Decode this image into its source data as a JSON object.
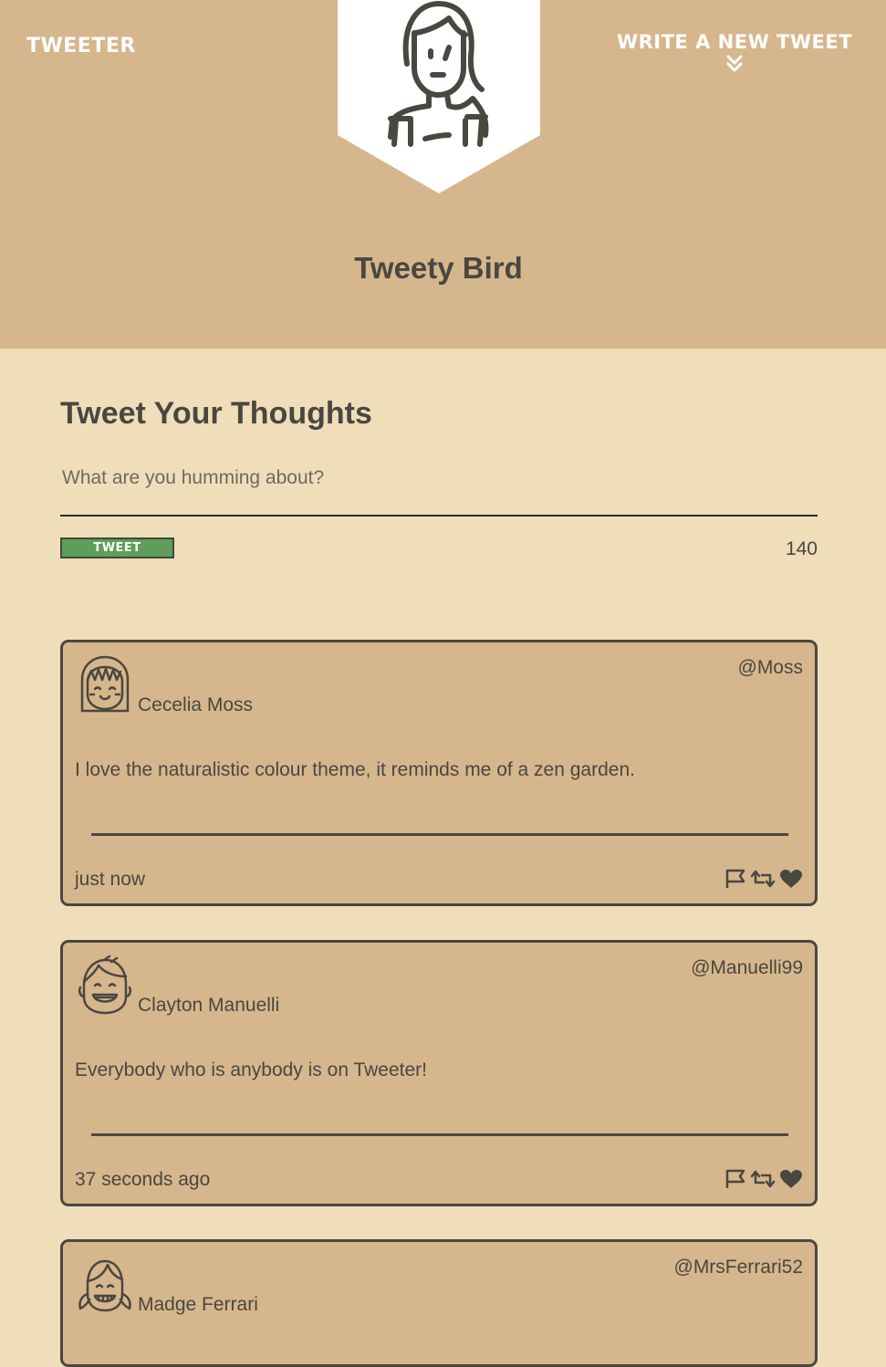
{
  "nav": {
    "brand": "TWEETER",
    "write_link": "WRITE A NEW TWEET"
  },
  "profile": {
    "name": "Tweety Bird",
    "avatar_icon": "woman-portrait-icon"
  },
  "compose": {
    "title": "Tweet Your Thoughts",
    "placeholder": "What are you humming about?",
    "button_label": "TWEET",
    "counter": "140"
  },
  "tweets": [
    {
      "author": "Cecelia Moss",
      "handle": "@Moss",
      "text": "I love the naturalistic colour theme, it reminds me of a zen garden.",
      "time": "just now",
      "avatar_icon": "girl-bangs-avatar-icon"
    },
    {
      "author": "Clayton Manuelli",
      "handle": "@Manuelli99",
      "text": "Everybody who is anybody is on Tweeter!",
      "time": "37 seconds ago",
      "avatar_icon": "smiling-boy-avatar-icon"
    },
    {
      "author": "Madge Ferrari",
      "handle": "@MrsFerrari52",
      "text": "",
      "time": "",
      "avatar_icon": "girl-pigtails-avatar-icon"
    }
  ],
  "colors": {
    "header_bg": "#d6b68c",
    "page_bg": "#efdeb9",
    "text": "#4a4741",
    "tweet_button": "#5e9e5a"
  }
}
